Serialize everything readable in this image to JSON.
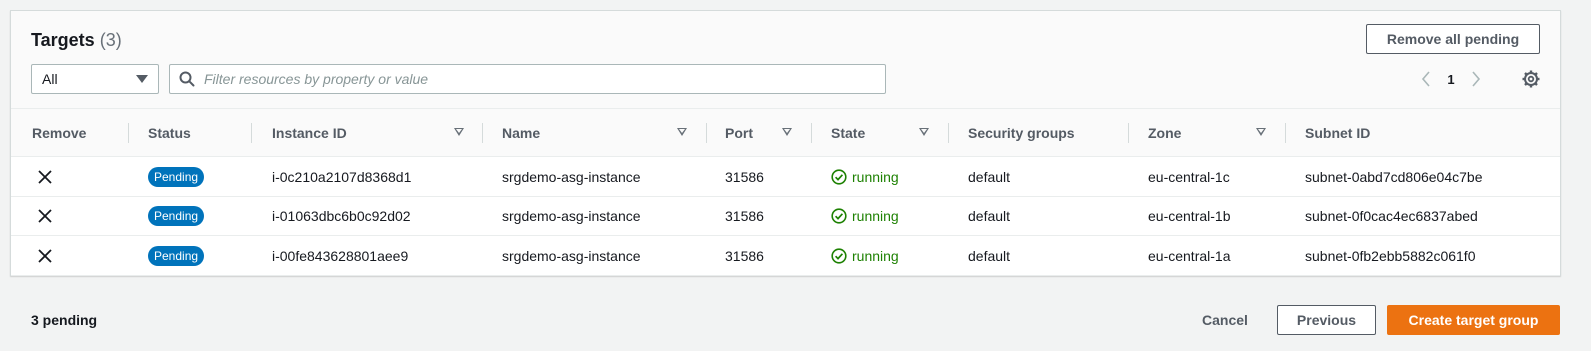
{
  "targets": {
    "title": "Targets",
    "count": "(3)",
    "remove_all_label": "Remove all pending",
    "filter_select_value": "All",
    "search_placeholder": "Filter resources by property or value",
    "page_number": "1",
    "columns": [
      "Remove",
      "Status",
      "Instance ID",
      "Name",
      "Port",
      "State",
      "Security groups",
      "Zone",
      "Subnet ID"
    ],
    "rows": [
      {
        "status": "Pending",
        "instance_id": "i-0c210a2107d8368d1",
        "name": "srgdemo-asg-instance",
        "port": "31586",
        "state": "running",
        "security_groups": "default",
        "zone": "eu-central-1c",
        "subnet_id": "subnet-0abd7cd806e04c7be"
      },
      {
        "status": "Pending",
        "instance_id": "i-01063dbc6b0c92d02",
        "name": "srgdemo-asg-instance",
        "port": "31586",
        "state": "running",
        "security_groups": "default",
        "zone": "eu-central-1b",
        "subnet_id": "subnet-0f0cac4ec6837abed"
      },
      {
        "status": "Pending",
        "instance_id": "i-00fe843628801aee9",
        "name": "srgdemo-asg-instance",
        "port": "31586",
        "state": "running",
        "security_groups": "default",
        "zone": "eu-central-1a",
        "subnet_id": "subnet-0fb2ebb5882c061f0"
      }
    ]
  },
  "footer": {
    "pending_text": "3 pending",
    "cancel_label": "Cancel",
    "previous_label": "Previous",
    "create_label": "Create target group"
  },
  "colors": {
    "badge": "#0073bb",
    "running": "#1d8102",
    "primary": "#ec7211"
  },
  "icons": {
    "remove": "close-icon",
    "state": "check-circle-icon",
    "search": "search-icon",
    "settings": "gear-icon"
  }
}
